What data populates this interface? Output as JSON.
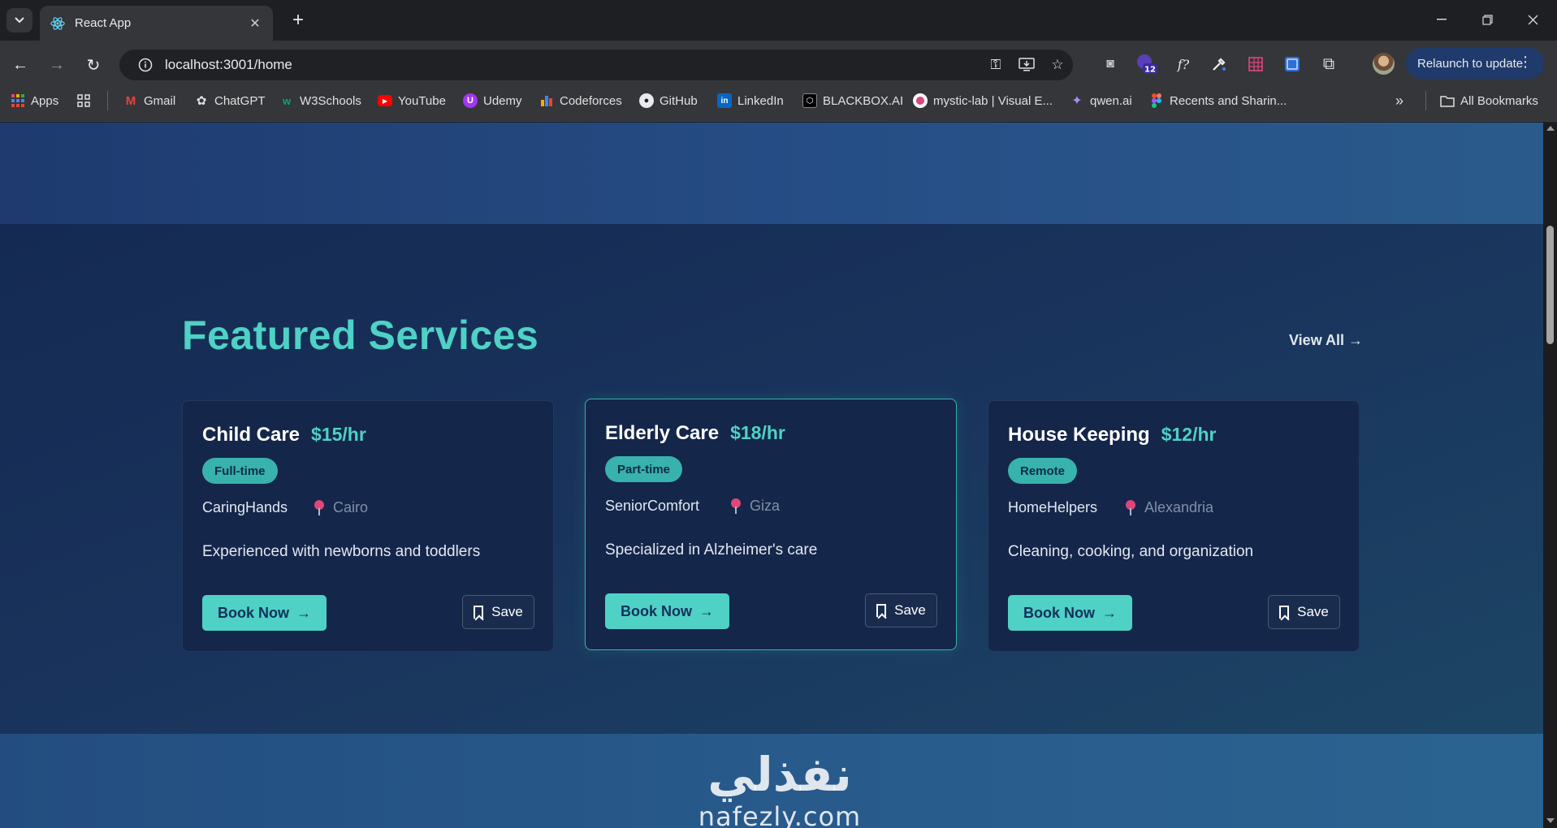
{
  "browser": {
    "tab": {
      "title": "React App"
    },
    "omnibox": {
      "url": "localhost:3001/home"
    },
    "extensions": {
      "badge_count": "12"
    },
    "relaunch_label": "Relaunch to update",
    "bookmarks": [
      {
        "label": "Apps",
        "icon": "apps-grid-icon"
      },
      {
        "label": "Gmail",
        "icon": "gmail-icon"
      },
      {
        "label": "ChatGPT",
        "icon": "chatgpt-icon"
      },
      {
        "label": "W3Schools",
        "icon": "w3schools-icon"
      },
      {
        "label": "YouTube",
        "icon": "youtube-icon"
      },
      {
        "label": "Udemy",
        "icon": "udemy-icon"
      },
      {
        "label": "Codeforces",
        "icon": "codeforces-icon"
      },
      {
        "label": "GitHub",
        "icon": "github-icon"
      },
      {
        "label": "LinkedIn",
        "icon": "linkedin-icon"
      },
      {
        "label": "BLACKBOX.AI",
        "icon": "blackbox-icon"
      },
      {
        "label": "mystic-lab | Visual E...",
        "icon": "mystic-lab-icon"
      },
      {
        "label": "qwen.ai",
        "icon": "qwen-icon"
      },
      {
        "label": "Recents and Sharin...",
        "icon": "figma-icon"
      }
    ],
    "all_bookmarks_label": "All Bookmarks"
  },
  "page": {
    "section_title": "Featured Services",
    "view_all_label": "View All →",
    "cards": [
      {
        "title": "Child Care",
        "price": "$15/hr",
        "badge": "Full-time",
        "provider": "CaringHands",
        "location": "Cairo",
        "description": "Experienced with newborns and toddlers",
        "book_label": "Book Now",
        "save_label": "Save"
      },
      {
        "title": "Elderly Care",
        "price": "$18/hr",
        "badge": "Part-time",
        "provider": "SeniorComfort",
        "location": "Giza",
        "description": "Specialized in Alzheimer's care",
        "book_label": "Book Now",
        "save_label": "Save"
      },
      {
        "title": "House Keeping",
        "price": "$12/hr",
        "badge": "Remote",
        "provider": "HomeHelpers",
        "location": "Alexandria",
        "description": "Cleaning, cooking, and organization",
        "book_label": "Book Now",
        "save_label": "Save"
      }
    ]
  },
  "watermark": {
    "arabic": "نفذلي",
    "latin": "nafezly.com"
  },
  "colors": {
    "accent": "#4fd1c5",
    "card_bg": "#14264a",
    "section_bg": "#19335c"
  }
}
